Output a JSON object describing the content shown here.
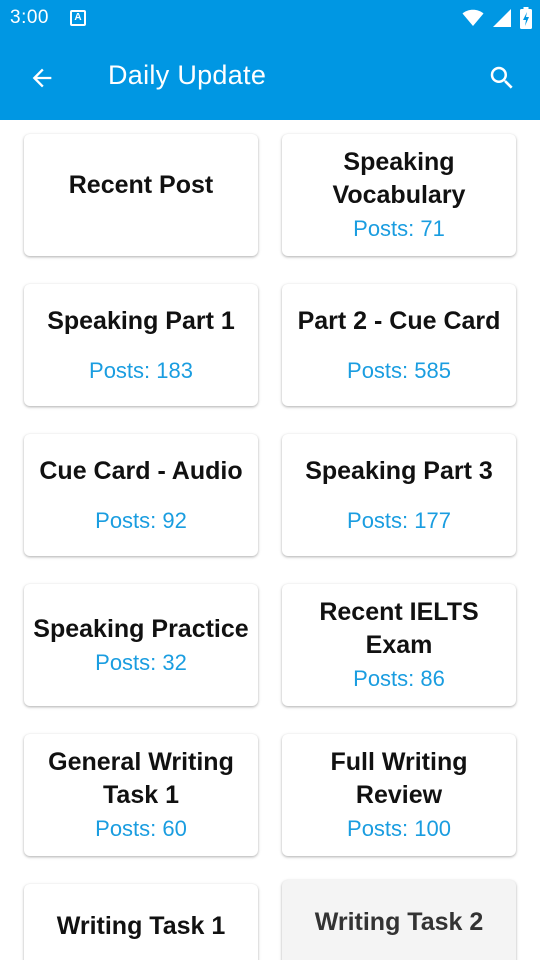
{
  "status_bar": {
    "time": "3:00",
    "notification_icon": "A",
    "icons": [
      "wifi-icon",
      "signal-icon",
      "battery-icon"
    ]
  },
  "app_bar": {
    "title": "Daily Update",
    "back_icon": "arrow-left-icon",
    "search_icon": "search-icon"
  },
  "categories": [
    {
      "title": "Recent Post",
      "count": ""
    },
    {
      "title": "Speaking Vocabulary",
      "count": "Posts: 71"
    },
    {
      "title": "Speaking Part 1",
      "count": "Posts: 183"
    },
    {
      "title": "Part 2 - Cue Card",
      "count": "Posts: 585"
    },
    {
      "title": "Cue Card - Audio",
      "count": "Posts: 92"
    },
    {
      "title": "Speaking Part 3",
      "count": "Posts: 177"
    },
    {
      "title": "Speaking Practice",
      "count": "Posts: 32"
    },
    {
      "title": "Recent IELTS Exam",
      "count": "Posts: 86"
    },
    {
      "title": "General Writing Task 1",
      "count": "Posts: 60"
    },
    {
      "title": "Full Writing Review",
      "count": "Posts: 100"
    },
    {
      "title": "Writing Task 1",
      "count": ""
    },
    {
      "title": "Writing Task 2",
      "count": ""
    }
  ],
  "colors": {
    "primary": "#0097e3",
    "count_text": "#1a9de0",
    "title_text": "#111111"
  }
}
